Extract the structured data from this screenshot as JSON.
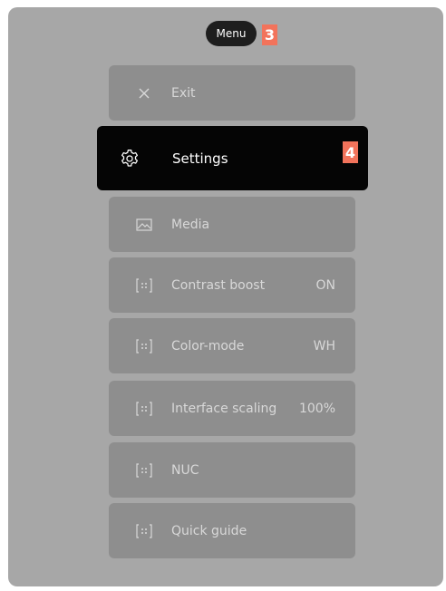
{
  "menu": {
    "title": "Menu"
  },
  "callouts": {
    "menu_marker": "3",
    "selected_marker": "4"
  },
  "items": [
    {
      "label": "Exit",
      "value": "",
      "icon": "close-icon"
    },
    {
      "label": "Settings",
      "value": "",
      "icon": "gear-icon"
    },
    {
      "label": "Media",
      "value": "",
      "icon": "image-icon"
    },
    {
      "label": "Contrast boost",
      "value": "ON",
      "icon": "frame-icon"
    },
    {
      "label": "Color-mode",
      "value": "WH",
      "icon": "frame-icon"
    },
    {
      "label": "Interface scaling",
      "value": "100%",
      "icon": "frame-icon"
    },
    {
      "label": "NUC",
      "value": "",
      "icon": "frame-icon"
    },
    {
      "label": "Quick guide",
      "value": "",
      "icon": "frame-icon"
    }
  ],
  "colors": {
    "screen": "#a7a7a7",
    "item": "#8e8e8e",
    "selected": "#050505",
    "callout": "#f2735b"
  }
}
